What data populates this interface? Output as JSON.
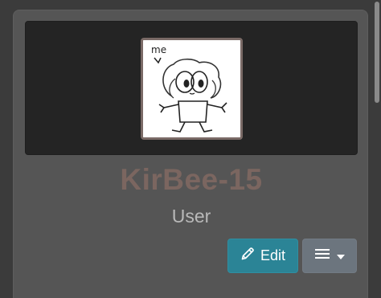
{
  "profile": {
    "username": "KirBee-15",
    "role": "User",
    "avatar_caption": "me"
  },
  "actions": {
    "edit_label": "Edit",
    "edit_icon": "pencil-icon",
    "menu_icon": "hamburger-icon",
    "menu_caret_icon": "caret-down-icon"
  },
  "colors": {
    "username": "#7b6660",
    "edit_button": "#2b8496",
    "menu_button": "#6c757e"
  }
}
